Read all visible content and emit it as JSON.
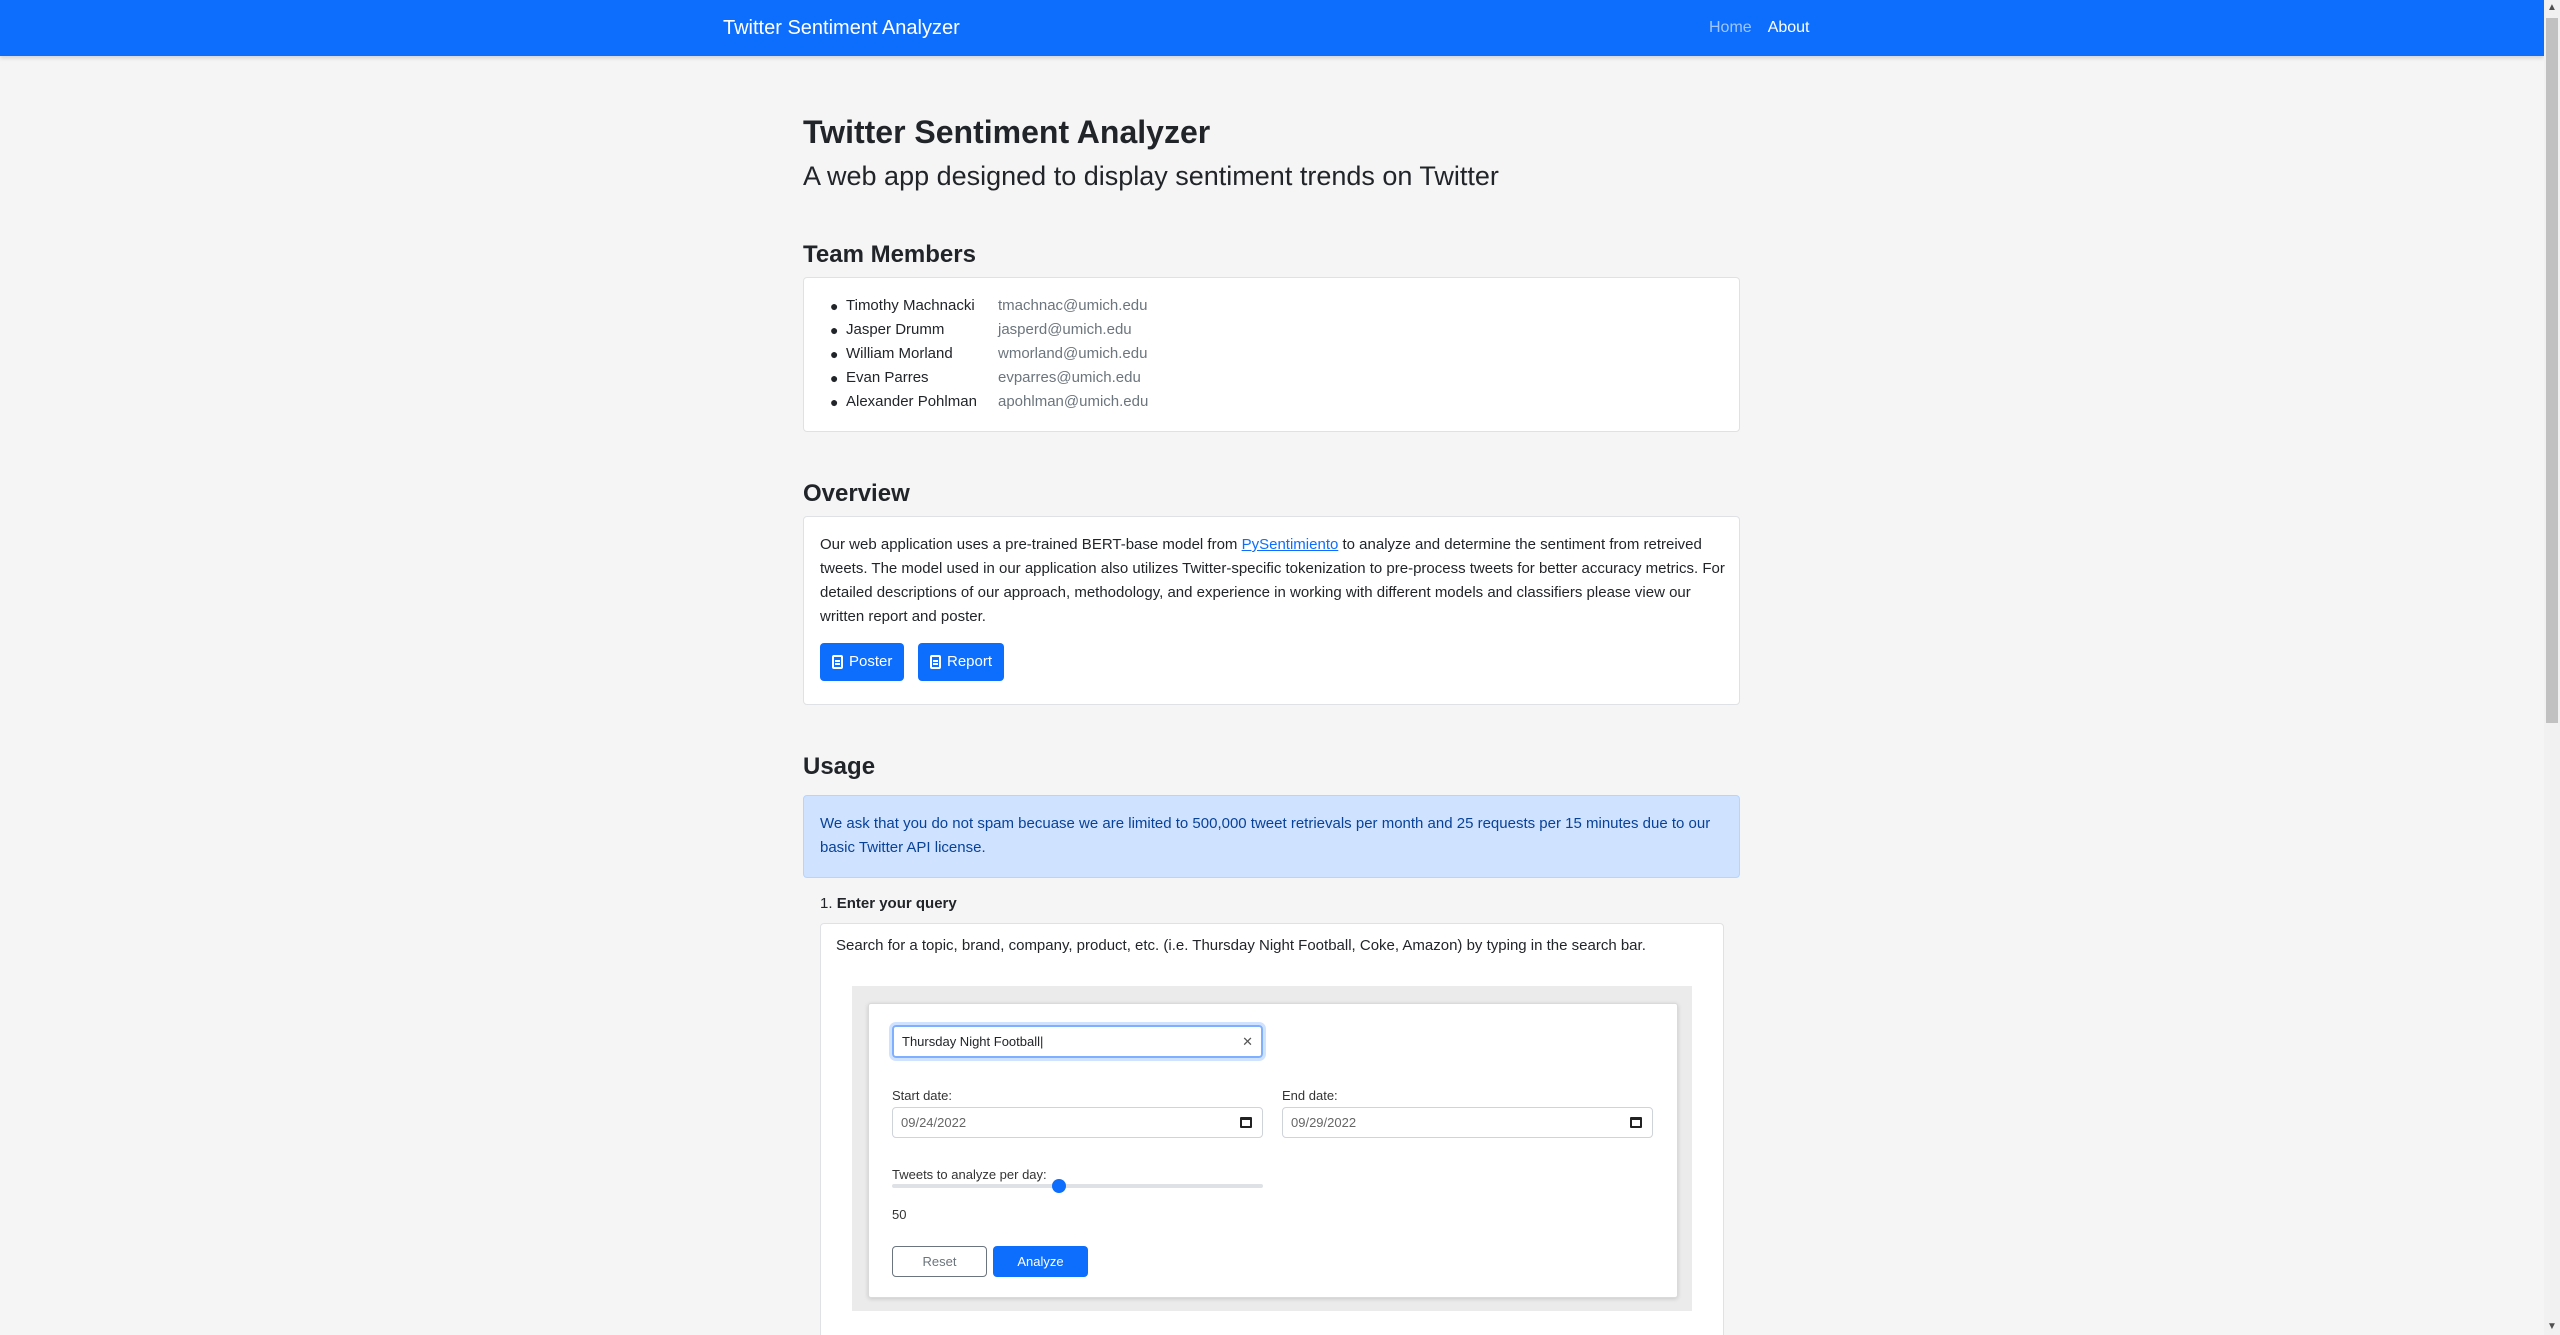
{
  "navbar": {
    "brand": "Twitter Sentiment Analyzer",
    "links": [
      {
        "label": "Home",
        "active": false
      },
      {
        "label": "About",
        "active": true
      }
    ]
  },
  "header": {
    "title": "Twitter Sentiment Analyzer",
    "subtitle": "A web app designed to display sentiment trends on Twitter"
  },
  "team": {
    "heading": "Team Members",
    "members": [
      {
        "name": "Timothy Machnacki",
        "email": "tmachnac@umich.edu"
      },
      {
        "name": "Jasper Drumm",
        "email": "jasperd@umich.edu"
      },
      {
        "name": "William Morland",
        "email": "wmorland@umich.edu"
      },
      {
        "name": "Evan Parres",
        "email": "evparres@umich.edu"
      },
      {
        "name": "Alexander Pohlman",
        "email": "apohlman@umich.edu"
      }
    ]
  },
  "overview": {
    "heading": "Overview",
    "text_before_link": "Our web application uses a pre-trained BERT-base model from ",
    "link_text": "PySentimiento",
    "text_after_link": " to analyze and determine the sentiment from retreived tweets. The model used in our application also utilizes Twitter-specific tokenization to pre-process tweets for better accuracy metrics. For detailed descriptions of our approach, methodology, and experience in working with different models and classifiers please view our written report and poster.",
    "poster_label": "Poster",
    "report_label": "Report"
  },
  "usage": {
    "heading": "Usage",
    "alert": "We ask that you do not spam becuase we are limited to 500,000 tweet retrievals per month and 25 requests per 15 minutes due to our basic Twitter API license.",
    "step1_number": "1.",
    "step1_title": "Enter your query",
    "step1_text": "Search for a topic, brand, company, product, etc. (i.e. Thursday Night Football, Coke, Amazon) by typing in the search bar."
  },
  "demo_form": {
    "query_value": "Thursday Night Football",
    "clear_glyph": "✕",
    "start_label": "Start date:",
    "start_value": "09/24/2022",
    "end_label": "End date:",
    "end_value": "09/29/2022",
    "tweets_label": "Tweets to analyze per day:",
    "tweets_value": "50",
    "tweets_fraction": 0.45,
    "reset_label": "Reset",
    "analyze_label": "Analyze"
  },
  "scrollbar": {
    "up_glyph": "▲",
    "down_glyph": "▼"
  },
  "colors": {
    "primary": "#0d6efd",
    "alert_bg": "#cfe2ff",
    "page_bg": "#f5f5f5"
  }
}
